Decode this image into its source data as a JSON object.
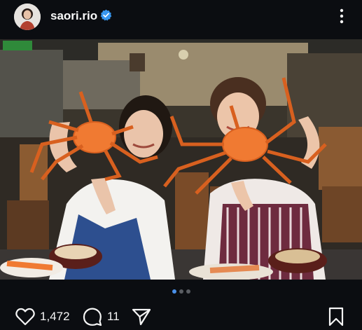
{
  "profile": {
    "username": "saori.rio",
    "verified": true,
    "avatar_icon": "profile-photo"
  },
  "post": {
    "image_icon": "photo-two-women-holding-crabs",
    "carousel": {
      "count": 3,
      "active_index": 0
    },
    "likes": "1,472",
    "comments": "11"
  },
  "icons": {
    "more": "vertical-ellipsis-icon",
    "like": "heart-icon",
    "comment": "comment-bubble-icon",
    "share": "paper-plane-icon",
    "save": "bookmark-icon"
  },
  "colors": {
    "background": "#0b0d11",
    "verified_badge": "#3897f0",
    "carousel_active": "#4a90e8",
    "crab": "#f07a32"
  }
}
